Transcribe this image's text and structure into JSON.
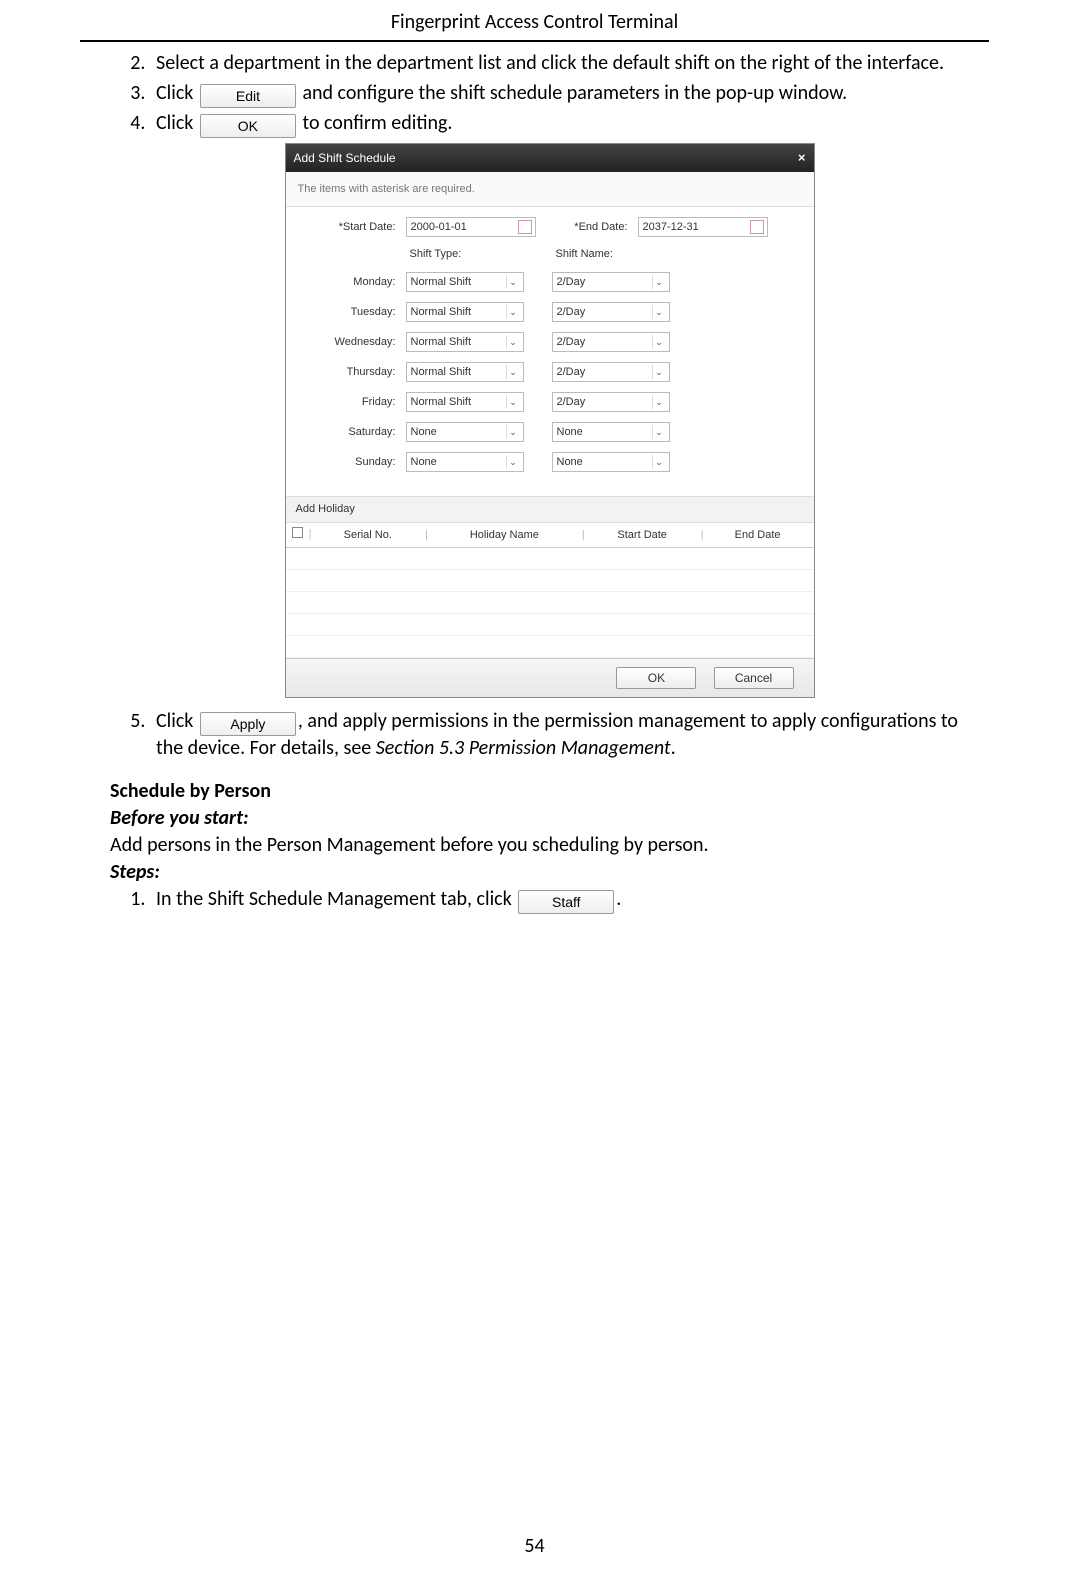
{
  "header": {
    "title": "Fingerprint Access Control Terminal"
  },
  "page_number": "54",
  "buttons": {
    "edit": "Edit",
    "ok": "OK",
    "apply": "Apply",
    "staff": "Staff"
  },
  "steps_a": {
    "s2": "Select a department in the department list and click the default shift on the right of the interface.",
    "s3_pre": "Click ",
    "s3_post": " and configure the shift schedule parameters in the pop-up window.",
    "s4_pre": "Click ",
    "s4_post": " to confirm editing.",
    "s5_pre": "Click ",
    "s5_mid": ", and apply permissions in the permission management to apply configurations to the device. For details, see ",
    "s5_ref": "Section 5.3 Permission Management",
    "s5_end": "."
  },
  "dialog": {
    "title": "Add Shift Schedule",
    "close": "×",
    "notice": "The items with asterisk are required.",
    "start_date_label": "*Start Date:",
    "start_date_value": "2000-01-01",
    "end_date_label": "*End Date:",
    "end_date_value": "2037-12-31",
    "shift_type_header": "Shift Type:",
    "shift_name_header": "Shift Name:",
    "days": [
      {
        "label": "Monday:",
        "type": "Normal Shift",
        "name": "2/Day"
      },
      {
        "label": "Tuesday:",
        "type": "Normal Shift",
        "name": "2/Day"
      },
      {
        "label": "Wednesday:",
        "type": "Normal Shift",
        "name": "2/Day"
      },
      {
        "label": "Thursday:",
        "type": "Normal Shift",
        "name": "2/Day"
      },
      {
        "label": "Friday:",
        "type": "Normal Shift",
        "name": "2/Day"
      },
      {
        "label": "Saturday:",
        "type": "None",
        "name": "None"
      },
      {
        "label": "Sunday:",
        "type": "None",
        "name": "None"
      }
    ],
    "add_holiday": "Add Holiday",
    "table": {
      "serial": "Serial No.",
      "holiday_name": "Holiday Name",
      "start_date": "Start Date",
      "end_date": "End Date"
    },
    "footer": {
      "ok": "OK",
      "cancel": "Cancel"
    }
  },
  "section2": {
    "title": "Schedule by Person",
    "before": "Before you start:",
    "before_text": "Add persons in the Person Management before you scheduling by person.",
    "steps_label": "Steps:",
    "step1_pre": "In the Shift Schedule Management tab, click ",
    "step1_post": "."
  }
}
